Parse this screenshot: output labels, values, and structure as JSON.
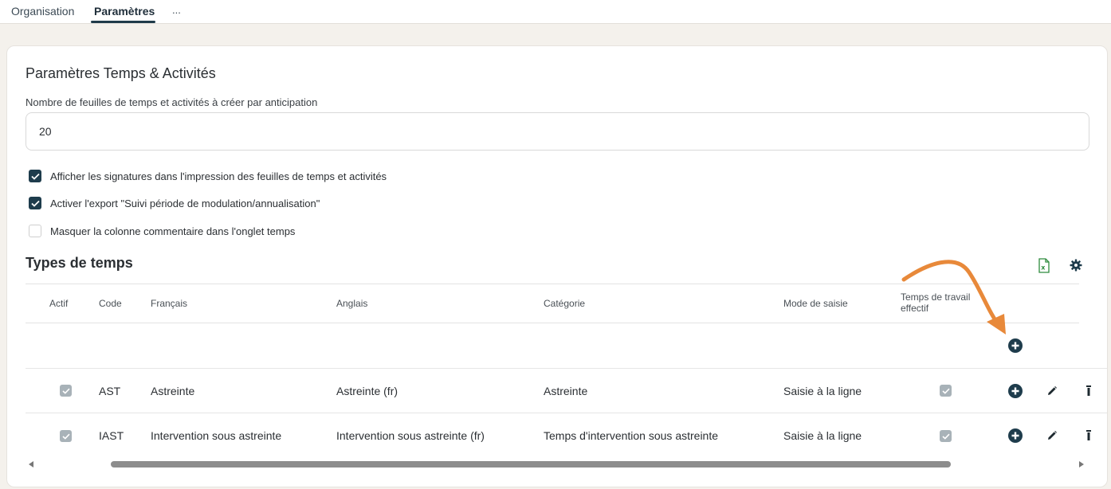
{
  "tabs": [
    {
      "label": "Organisation"
    },
    {
      "label": "Paramètres",
      "active": true
    },
    {
      "label": "..."
    }
  ],
  "card": {
    "title": "Paramètres Temps & Activités",
    "anticipation": {
      "label": "Nombre de feuilles de temps et activités à créer par anticipation",
      "value": "20"
    },
    "options": [
      {
        "label": "Afficher les signatures dans l'impression des feuilles de temps et activités",
        "checked": true
      },
      {
        "label": "Activer l'export \"Suivi période de modulation/annualisation\"",
        "checked": true
      },
      {
        "label": "Masquer la colonne commentaire dans l'onglet temps",
        "checked": false
      }
    ]
  },
  "types": {
    "title": "Types de temps",
    "toolbar_icons": [
      "excel-export-icon",
      "gear-icon"
    ],
    "columns": [
      "Actif",
      "Code",
      "Français",
      "Anglais",
      "Catégorie",
      "Mode de saisie",
      "Temps de travail effectif"
    ],
    "rows": [
      {
        "actif": true,
        "code": "AST",
        "francais": "Astreinte",
        "anglais": "Astreinte (fr)",
        "categorie": "Astreinte",
        "mode": "Saisie à la ligne",
        "effectif": true
      },
      {
        "actif": true,
        "code": "IAST",
        "francais": "Intervention sous astreinte",
        "anglais": "Intervention sous astreinte (fr)",
        "categorie": "Temps d'intervention sous astreinte",
        "mode": "Saisie à la ligne",
        "effectif": true
      }
    ],
    "row_actions": [
      "plus-circle-icon",
      "pencil-icon",
      "delete-icon"
    ]
  },
  "colors": {
    "accent": "#1e3c4c",
    "annotation_arrow": "#e8893a",
    "excel_green": "#2e8b3d",
    "background": "#f4f1ec"
  },
  "scroll": {
    "horizontal_position": 0.1
  }
}
